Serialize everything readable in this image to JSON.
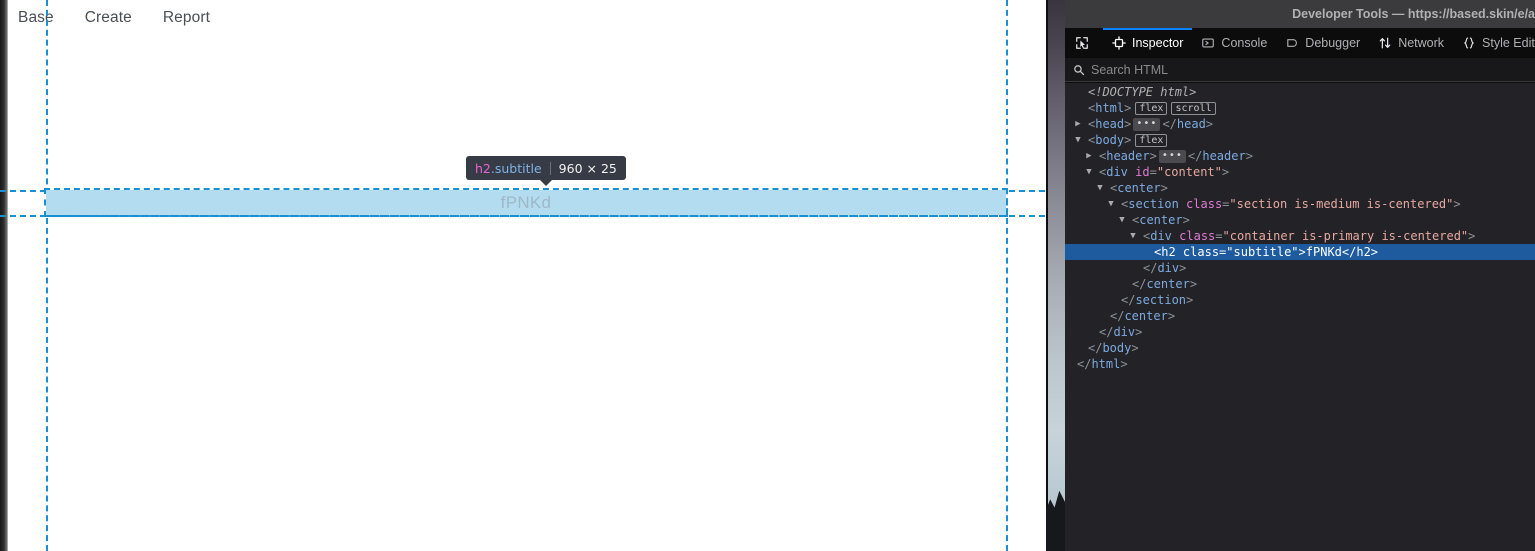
{
  "page": {
    "nav": [
      {
        "label": "Base"
      },
      {
        "label": "Create"
      },
      {
        "label": "Report"
      }
    ],
    "highlighted_element": {
      "text": "fPNKd",
      "infobar_tag": "h2",
      "infobar_class": ".subtitle",
      "infobar_dimensions": "960 × 25",
      "highlight_fill": "#b3dcf0",
      "guide_color": "#1a8fd1"
    }
  },
  "devtools": {
    "title": "Developer Tools — https://based.skin/e/a",
    "picker_icon": "node-picker-icon",
    "tabs": [
      {
        "label": "Inspector",
        "icon": "inspector-icon",
        "active": true
      },
      {
        "label": "Console",
        "icon": "console-icon",
        "active": false
      },
      {
        "label": "Debugger",
        "icon": "debugger-icon",
        "active": false
      },
      {
        "label": "Network",
        "icon": "network-icon",
        "active": false
      },
      {
        "label": "Style Edit",
        "icon": "style-editor-icon",
        "active": false
      }
    ],
    "accent_color": "#0a84ff",
    "search": {
      "placeholder": "Search HTML",
      "value": "",
      "icon": "search-icon"
    },
    "markup": {
      "selected_index": 8,
      "rows": [
        {
          "indent": 1,
          "twisty": "",
          "html": "<span class=\"tok-doctype\">&lt;!DOCTYPE html&gt;</span>"
        },
        {
          "indent": 1,
          "twisty": "",
          "html": "<span class=\"tok-punct\">&lt;</span><span class=\"tok-tag\">html</span><span class=\"tok-punct\">&gt;</span><span class=\"badge\" data-name=\"flex-badge\">flex</span><span class=\"badge\" data-name=\"scroll-badge\">scroll</span>"
        },
        {
          "indent": 1,
          "twisty": "▶",
          "html": "<span class=\"tok-punct\">&lt;</span><span class=\"tok-tag\">head</span><span class=\"tok-punct\">&gt;</span><span class=\"ellipsis-badge\" data-name=\"collapsed-content-badge\">•••</span><span class=\"tok-punct\">&lt;/</span><span class=\"tok-tag\">head</span><span class=\"tok-punct\">&gt;</span>"
        },
        {
          "indent": 1,
          "twisty": "▼",
          "html": "<span class=\"tok-punct\">&lt;</span><span class=\"tok-tag\">body</span><span class=\"tok-punct\">&gt;</span><span class=\"badge\" data-name=\"flex-badge\">flex</span>"
        },
        {
          "indent": 2,
          "twisty": "▶",
          "html": "<span class=\"tok-punct\">&lt;</span><span class=\"tok-tag\">header</span><span class=\"tok-punct\">&gt;</span><span class=\"ellipsis-badge\" data-name=\"collapsed-content-badge\">•••</span><span class=\"tok-punct\">&lt;/</span><span class=\"tok-tag\">header</span><span class=\"tok-punct\">&gt;</span>"
        },
        {
          "indent": 2,
          "twisty": "▼",
          "html": "<span class=\"tok-punct\">&lt;</span><span class=\"tok-tag\">div</span> <span class=\"tok-attr\">id</span><span class=\"tok-eq\">=</span><span class=\"tok-val\">\"content\"</span><span class=\"tok-punct\">&gt;</span>"
        },
        {
          "indent": 3,
          "twisty": "▼",
          "html": "<span class=\"tok-punct\">&lt;</span><span class=\"tok-tag\">center</span><span class=\"tok-punct\">&gt;</span>"
        },
        {
          "indent": 4,
          "twisty": "▼",
          "html": "<span class=\"tok-punct\">&lt;</span><span class=\"tok-tag\">section</span> <span class=\"tok-attr\">class</span><span class=\"tok-eq\">=</span><span class=\"tok-val\">\"section is-medium is-centered\"</span><span class=\"tok-punct\">&gt;</span>"
        },
        {
          "indent": 5,
          "twisty": "▼",
          "html": "<span class=\"tok-punct\">&lt;</span><span class=\"tok-tag\">center</span><span class=\"tok-punct\">&gt;</span>"
        },
        {
          "indent": 6,
          "twisty": "▼",
          "html": "<span class=\"tok-punct\">&lt;</span><span class=\"tok-tag\">div</span> <span class=\"tok-attr\">class</span><span class=\"tok-eq\">=</span><span class=\"tok-val\">\"container is-primary is-centered\"</span><span class=\"tok-punct\">&gt;</span>"
        },
        {
          "indent": 7,
          "twisty": "",
          "selected": true,
          "html": "<span class=\"tok-punct\">&lt;</span><span class=\"tok-tag\">h2</span> <span class=\"tok-attr\">class</span><span class=\"tok-eq\">=</span><span class=\"tok-val\">\"subtitle\"</span><span class=\"tok-punct\">&gt;</span><span class=\"tok-text\">fPNKd</span><span class=\"tok-punct\">&lt;/</span><span class=\"tok-tag\">h2</span><span class=\"tok-punct\">&gt;</span>"
        },
        {
          "indent": 6,
          "twisty": "",
          "html": "<span class=\"tok-punct\">&lt;/</span><span class=\"tok-tag\">div</span><span class=\"tok-punct\">&gt;</span>"
        },
        {
          "indent": 5,
          "twisty": "",
          "html": "<span class=\"tok-punct\">&lt;/</span><span class=\"tok-tag\">center</span><span class=\"tok-punct\">&gt;</span>"
        },
        {
          "indent": 4,
          "twisty": "",
          "html": "<span class=\"tok-punct\">&lt;/</span><span class=\"tok-tag\">section</span><span class=\"tok-punct\">&gt;</span>"
        },
        {
          "indent": 3,
          "twisty": "",
          "html": "<span class=\"tok-punct\">&lt;/</span><span class=\"tok-tag\">center</span><span class=\"tok-punct\">&gt;</span>"
        },
        {
          "indent": 2,
          "twisty": "",
          "html": "<span class=\"tok-punct\">&lt;/</span><span class=\"tok-tag\">div</span><span class=\"tok-punct\">&gt;</span>"
        },
        {
          "indent": 1,
          "twisty": "",
          "html": "<span class=\"tok-punct\">&lt;/</span><span class=\"tok-tag\">body</span><span class=\"tok-punct\">&gt;</span>"
        },
        {
          "indent": 0,
          "twisty": "",
          "html": "<span class=\"tok-punct\">&lt;/</span><span class=\"tok-tag\">html</span><span class=\"tok-punct\">&gt;</span>"
        }
      ]
    }
  }
}
